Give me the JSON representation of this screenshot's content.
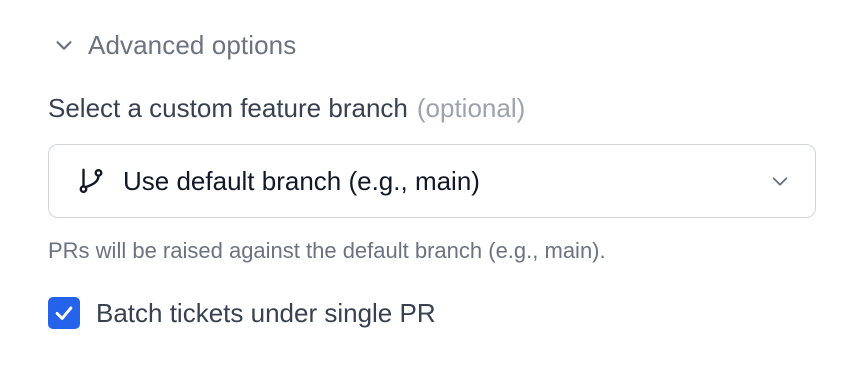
{
  "advanced": {
    "label": "Advanced options",
    "toggle_icon": "chevron-down-icon"
  },
  "branch_field": {
    "label": "Select a custom feature branch",
    "optional_label": "(optional)",
    "selected_value": "Use default branch (e.g., main)",
    "leading_icon": "git-branch-icon",
    "trailing_icon": "chevron-down-icon",
    "helper_text": "PRs will be raised against the default branch (e.g., main)."
  },
  "batch_option": {
    "label": "Batch tickets under single PR",
    "checked": true
  },
  "colors": {
    "accent": "#2563eb",
    "muted_text": "#6b7280",
    "label_text": "#374151",
    "border": "#d1d5db"
  }
}
